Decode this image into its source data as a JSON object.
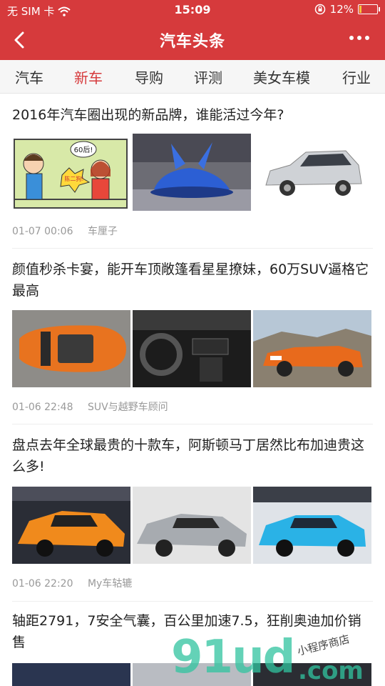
{
  "status_bar": {
    "carrier": "无 SIM 卡",
    "time": "15:09",
    "battery": "12%",
    "battery_level": 0.12
  },
  "header": {
    "title": "汽车头条"
  },
  "tabs": [
    {
      "label": "汽车",
      "active": false
    },
    {
      "label": "新车",
      "active": true
    },
    {
      "label": "导购",
      "active": false
    },
    {
      "label": "评测",
      "active": false
    },
    {
      "label": "美女车模",
      "active": false
    },
    {
      "label": "行业",
      "active": false
    }
  ],
  "articles": [
    {
      "title": "2016年汽车圈出现的新品牌，谁能活过今年?",
      "date": "01-07 00:06",
      "source": "车厘子",
      "images": [
        "cartoon-image",
        "blue-supercar-image",
        "silver-suv-image"
      ]
    },
    {
      "title": "颜值秒杀卡宴，能开车顶敞篷看星星撩妹，60万SUV逼格它最高",
      "date": "01-06 22:48",
      "source": "SUV与越野车顾问",
      "images": [
        "orange-convertible-top-image",
        "car-interior-image",
        "orange-convertible-side-image"
      ]
    },
    {
      "title": "盘点去年全球最贵的十款车，阿斯顿马丁居然比布加迪贵这么多!",
      "date": "01-06 22:20",
      "source": "My车轱辘",
      "images": [
        "orange-hypercar-image",
        "silver-hypercar-image",
        "blue-bugatti-image"
      ]
    },
    {
      "title": "轴距2791，7安全气囊，百公里加速7.5，狂削奥迪加价销售",
      "date": "",
      "source": "",
      "images": [
        "partial-image-1",
        "partial-image-2",
        "partial-image-3"
      ]
    }
  ],
  "watermark": {
    "text": "91ud",
    "suffix": ".com",
    "tagline": "小程序商店"
  },
  "colors": {
    "brand_red": "#d63a3c",
    "watermark_green": "#31c4a0"
  }
}
